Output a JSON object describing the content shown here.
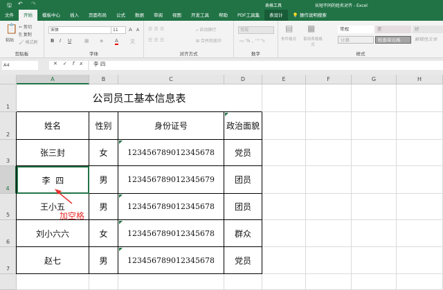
{
  "titlebar": {
    "title": "长短不同的姓名对齐 - Excel",
    "context": "表格工具"
  },
  "tabs": [
    "文件",
    "开始",
    "模板中心",
    "插入",
    "页面布局",
    "公式",
    "数据",
    "审阅",
    "视图",
    "开发工具",
    "帮助",
    "PDF工具集",
    "表设计",
    "操作说明搜索"
  ],
  "ribbon": {
    "clipboard": {
      "paste": "粘贴",
      "cut": "剪切",
      "copy": "复制",
      "format_painter": "格式刷",
      "label": "剪贴板"
    },
    "font": {
      "name": "宋体",
      "size": "11",
      "label": "字体"
    },
    "alignment": {
      "wrap": "自动换行",
      "merge": "合并后居中",
      "label": "对齐方式"
    },
    "number": {
      "format": "常规",
      "label": "数字"
    },
    "styles": {
      "conditional": "条件格式",
      "table": "套用表格格式",
      "normal": "常规",
      "bad": "差",
      "good": "好",
      "calc": "计算",
      "check": "检查单元格",
      "explain": "解释性文本",
      "label": "样式"
    }
  },
  "formula_bar": {
    "name_box": "A4",
    "content": "李 四"
  },
  "columns": [
    "A",
    "B",
    "C",
    "D",
    "E",
    "F",
    "G",
    "H"
  ],
  "rows": [
    "1",
    "2",
    "3",
    "4",
    "5",
    "6",
    "7"
  ],
  "sheet": {
    "title": "公司员工基本信息表",
    "headers": [
      "姓名",
      "性别",
      "身份证号",
      "政治面貌"
    ],
    "data": [
      [
        "张三封",
        "女",
        "123456789012345678",
        "党员"
      ],
      [
        "李  四",
        "男",
        "123456789012345679",
        "团员"
      ],
      [
        "王小五",
        "男",
        "123456789012345678",
        "团员"
      ],
      [
        "刘小六六",
        "女",
        "123456789012345678",
        "群众"
      ],
      [
        "赵七",
        "男",
        "123456789012345678",
        "党员"
      ]
    ]
  },
  "annotation": "加空格"
}
